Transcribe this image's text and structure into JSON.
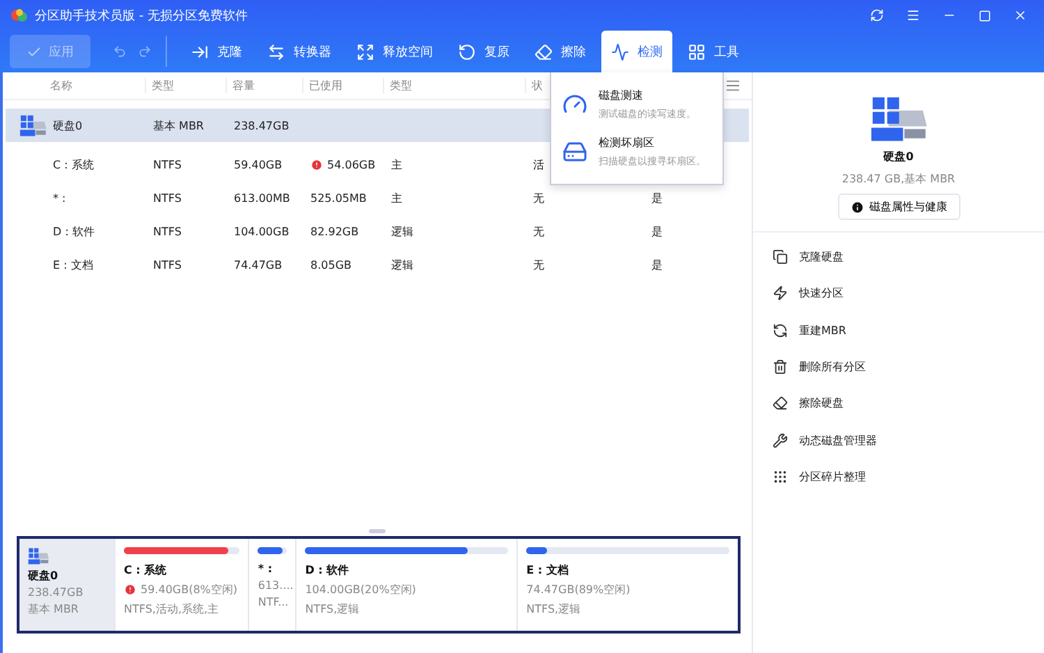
{
  "window": {
    "title": "分区助手技术员版 - 无损分区免费软件"
  },
  "toolbar": {
    "apply": {
      "label": "应用",
      "disabled": true
    },
    "tools": [
      {
        "label": "克隆",
        "selected": false
      },
      {
        "label": "转换器",
        "selected": false
      },
      {
        "label": "释放空间",
        "selected": false
      },
      {
        "label": "复原",
        "selected": false
      },
      {
        "label": "擦除",
        "selected": false
      },
      {
        "label": "检测",
        "selected": true
      },
      {
        "label": "工具",
        "selected": false
      }
    ]
  },
  "dropdown": [
    {
      "title": "磁盘测速",
      "description": "测试磁盘的读写速度。"
    },
    {
      "title": "检测坏扇区",
      "description": "扫描硬盘以搜寻坏扇区。"
    }
  ],
  "table": {
    "columns": [
      "名称",
      "类型",
      "容量",
      "已使用",
      "类型",
      "状"
    ],
    "disk": {
      "name": "硬盘0",
      "type": "基本 MBR",
      "capacity": "238.47GB",
      "selected": true
    },
    "rows": [
      {
        "name": "C : 系统",
        "fs": "NTFS",
        "capacity": "59.40GB",
        "used": "54.06GB",
        "warning": true,
        "kind": "主",
        "status": "活",
        "column_7": ""
      },
      {
        "name": "* :",
        "fs": "NTFS",
        "capacity": "613.00MB",
        "used": "525.05MB",
        "warning": false,
        "kind": "主",
        "status": "无",
        "column_7": "是"
      },
      {
        "name": "D : 软件",
        "fs": "NTFS",
        "capacity": "104.00GB",
        "used": "82.92GB",
        "warning": false,
        "kind": "逻辑",
        "status": "无",
        "column_7": "是"
      },
      {
        "name": "E : 文档",
        "fs": "NTFS",
        "capacity": "74.47GB",
        "used": "8.05GB",
        "warning": false,
        "kind": "逻辑",
        "status": "无",
        "column_7": "是"
      }
    ]
  },
  "disk_map": {
    "disk": {
      "name": "硬盘0",
      "size": "238.47GB",
      "type": "基本 MBR"
    },
    "partitions": [
      {
        "name": "C : 系统",
        "info": "59.40GB(8%空闲)",
        "detail": "NTFS,活动,系统,主",
        "level": 0.9,
        "warning": true
      },
      {
        "name": "* :",
        "info": "613....",
        "detail": "NTF...",
        "level": 0.85,
        "warning": false
      },
      {
        "name": "D : 软件",
        "info": "104.00GB(20%空闲)",
        "detail": "NTFS,逻辑",
        "level": 0.8,
        "warning": false
      },
      {
        "name": "E : 文档",
        "info": "74.47GB(89%空闲)",
        "detail": "NTFS,逻辑",
        "level": 0.1,
        "warning": false
      }
    ]
  },
  "side_panel": {
    "disk_name": "硬盘0",
    "disk_info": "238.47 GB,基本 MBR",
    "health_button": "磁盘属性与健康",
    "actions": [
      "克隆硬盘",
      "快速分区",
      "重建MBR",
      "删除所有分区",
      "擦除硬盘",
      "动态磁盘管理器",
      "分区碎片整理"
    ]
  }
}
